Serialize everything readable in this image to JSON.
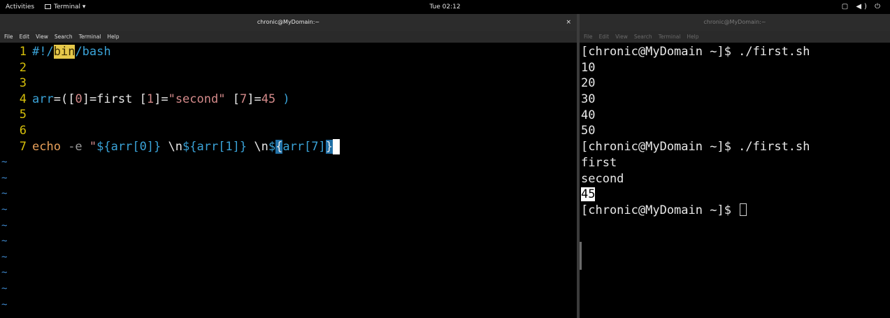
{
  "topbar": {
    "activities": "Activities",
    "app_menu": "Terminal ▾",
    "clock": "Tue 02:12",
    "tray": "▢ ◀) ⏻"
  },
  "left_terminal": {
    "title": "chronic@MyDomain:~",
    "close": "×",
    "menu": [
      "File",
      "Edit",
      "View",
      "Search",
      "Terminal",
      "Help"
    ],
    "vim": {
      "lines": [
        {
          "num": "1",
          "segments": [
            {
              "text": "#!/",
              "style": "c-cyan"
            },
            {
              "text": "bin",
              "style": "hl-yellow"
            },
            {
              "text": "/bash",
              "style": "c-cyan"
            }
          ]
        },
        {
          "num": "2",
          "segments": []
        },
        {
          "num": "3",
          "segments": []
        },
        {
          "num": "4",
          "segments": [
            {
              "text": "arr",
              "style": "c-cyan"
            },
            {
              "text": "=(",
              "style": "c-white"
            },
            {
              "text": "[",
              "style": "c-white"
            },
            {
              "text": "0",
              "style": "c-red"
            },
            {
              "text": "]=first ",
              "style": "c-white"
            },
            {
              "text": "[",
              "style": "c-white"
            },
            {
              "text": "1",
              "style": "c-red"
            },
            {
              "text": "]=",
              "style": "c-white"
            },
            {
              "text": "\"second\"",
              "style": "c-red"
            },
            {
              "text": " [",
              "style": "c-white"
            },
            {
              "text": "7",
              "style": "c-red"
            },
            {
              "text": "]=",
              "style": "c-white"
            },
            {
              "text": "45",
              "style": "c-red"
            },
            {
              "text": " )",
              "style": "c-cyan"
            }
          ]
        },
        {
          "num": "5",
          "segments": []
        },
        {
          "num": "6",
          "segments": []
        },
        {
          "num": "7",
          "segments": [
            {
              "text": "echo",
              "style": "c-orange"
            },
            {
              "text": " -e ",
              "style": "c-grey"
            },
            {
              "text": "\"",
              "style": "c-red"
            },
            {
              "text": "${arr[0]}",
              "style": "c-cyan"
            },
            {
              "text": " \\n",
              "style": "c-white"
            },
            {
              "text": "${arr[1]}",
              "style": "c-cyan"
            },
            {
              "text": " \\n",
              "style": "c-white"
            },
            {
              "text": "$",
              "style": "c-cyan"
            },
            {
              "text": "{",
              "style": "hl-blue"
            },
            {
              "text": "arr[7]",
              "style": "c-cyan"
            },
            {
              "text": "}",
              "style": "hl-blue"
            },
            {
              "text": " ",
              "style": "cursor-block"
            }
          ]
        }
      ],
      "tilde": "~",
      "tilde_count": 10
    }
  },
  "right_terminal": {
    "title": "chronic@MyDomain:~",
    "menu": [
      "File",
      "Edit",
      "View",
      "Search",
      "Terminal",
      "Help"
    ],
    "lines": [
      {
        "text": "[chronic@MyDomain ~]$ ./first.sh"
      },
      {
        "text": "10"
      },
      {
        "text": "20"
      },
      {
        "text": "30"
      },
      {
        "text": "40"
      },
      {
        "text": "50"
      },
      {
        "text": "[chronic@MyDomain ~]$ ./first.sh"
      },
      {
        "text": "first"
      },
      {
        "text": "second"
      },
      {
        "text": "45",
        "inverse": true
      },
      {
        "text": "[chronic@MyDomain ~]$ ",
        "cursor": true
      }
    ]
  },
  "colors": {
    "line_number": "#d7c00a",
    "keyword_cyan": "#3aa3d8",
    "string_red": "#d48a8a",
    "tilde_blue": "#3f8ad0"
  }
}
